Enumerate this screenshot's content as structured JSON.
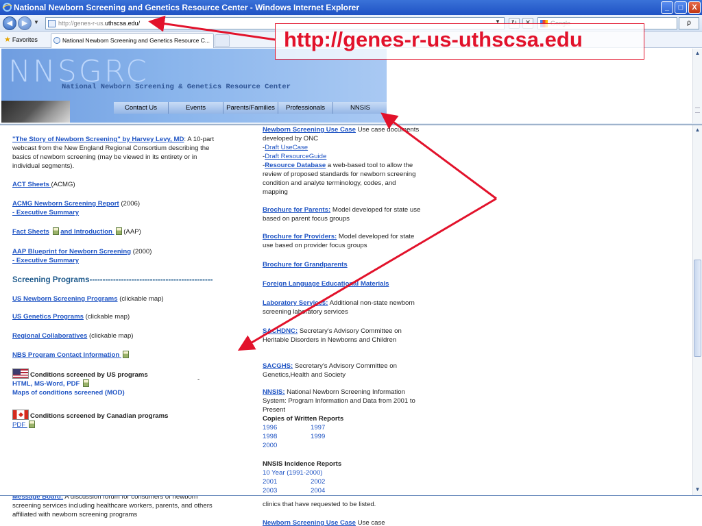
{
  "window": {
    "title": "National Newborn Screening and Genetics Resource Center - Windows Internet Explorer",
    "controls": [
      "_",
      "□",
      "X"
    ]
  },
  "browser": {
    "address_prefix": "http://genes-r-us.",
    "address_host": "uthscsa.edu/",
    "search_placeholder": "Google",
    "favorites_label": "Favorites",
    "tab_title": "National Newborn Screening and Genetics Resource C...",
    "search_button": "ρ"
  },
  "banner": {
    "logo": "NNSGRC",
    "subtitle": "National Newborn Screening & Genetics Resource Center",
    "menu": [
      "Contact Us",
      "Events",
      "Parents/Families",
      "Professionals",
      "NNSIS"
    ]
  },
  "left": {
    "story_link": "\"The Story of Newborn Screening\" by Harvey Levy, MD",
    "story_text": ": A 10-part webcast from the New England Regional Consortium describing the basics of newborn screening (may be viewed in its entirety or in individual segments).",
    "act_link": "ACT Sheets ",
    "act_text": "(ACMG)",
    "acmg_link": "ACMG Newborn Screening Report",
    "acmg_text": " (2006)",
    "acmg_exec": "- Executive Summary",
    "fact_link": "Fact Sheets",
    "intro_link": "and Introduction ",
    "intro_text": "(AAP)",
    "aap_link": "AAP Blueprint for Newborn Screening",
    "aap_text": " (2000)",
    "aap_exec": "- Executive Summary",
    "screening_header": "Screening Programs-----------------------------------------------",
    "us_nbs_link": "US Newborn Screening Programs",
    "us_nbs_text": " (clickable map)",
    "us_gen_link": "US Genetics Programs",
    "us_gen_text": " (clickable map)",
    "regional_link": "Regional Collaboratives",
    "regional_text": " (clickable map)",
    "contact_link": "NBS Program Contact Information ",
    "us_conditions": "Conditions screened by US programs",
    "us_formats": "HTML,  MS-Word,  PDF ",
    "maps_link": "Maps of conditions screened (MOD)",
    "dash": "-",
    "ca_conditions": "Conditions screened by Canadian programs",
    "ca_pdf": "PDF "
  },
  "right": {
    "usecase_link": "Newborn Screening Use Case",
    "usecase_text": " Use case documents developed by ONC",
    "draft_usecase": "Draft UseCase",
    "draft_guide": "Draft ResourceGuide",
    "resdb_link": "Resource Database",
    "resdb_text": " a web-based tool to allow the review of proposed standards for newborn screening condition and analyte terminology, codes, and mapping",
    "parents_link": "Brochure for Parents:",
    "parents_text": " Model developed for state use based on parent focus groups",
    "providers_link": "Brochure for Providers:",
    "providers_text": " Model developed for state use based on provider focus groups",
    "grand_link": "Brochure for Grandparents",
    "foreign_link": "Foreign Language Educational Materials",
    "lab_link": "Laboratory Services:",
    "lab_text": " Additional non-state newborn screening laboratory services",
    "sachdnc_link": "SACHDNC:",
    "sachdnc_text": " Secretary's Advisory Committee on Heritable Disorders in Newborns and Children",
    "sacghs_link": "SACGHS:",
    "sacghs_text": " Secretary's Advisory Committee on Genetics,Health and Society",
    "nnsis_link": "NNSIS:",
    "nnsis_text": " National Newborn Screening Information System: Program Information and Data from 2001 to Present",
    "copies_label": "Copies of Written Reports",
    "years": [
      "1996",
      "1997",
      "1998",
      "1999",
      "2000"
    ],
    "incidence_label": "NNSIS Incidence Reports",
    "ten_year": "10 Year (1991-2000)",
    "inc_years": [
      "2001",
      "2002",
      "2003",
      "2004"
    ]
  },
  "bottom": {
    "msg_link": "Message Board:",
    "msg_text": " A discussion forum for consumers of newborn screening services including healthcare workers, parents, and others affiliated with newborn screening programs",
    "clinics_text": "clinics that have requested to be listed.",
    "usecase_link": "Newborn Screening Use Case",
    "usecase_text": " Use case"
  },
  "annotation": {
    "url_callout": "http://genes-r-us-uthscsa.edu",
    "color": "#e2122b"
  }
}
